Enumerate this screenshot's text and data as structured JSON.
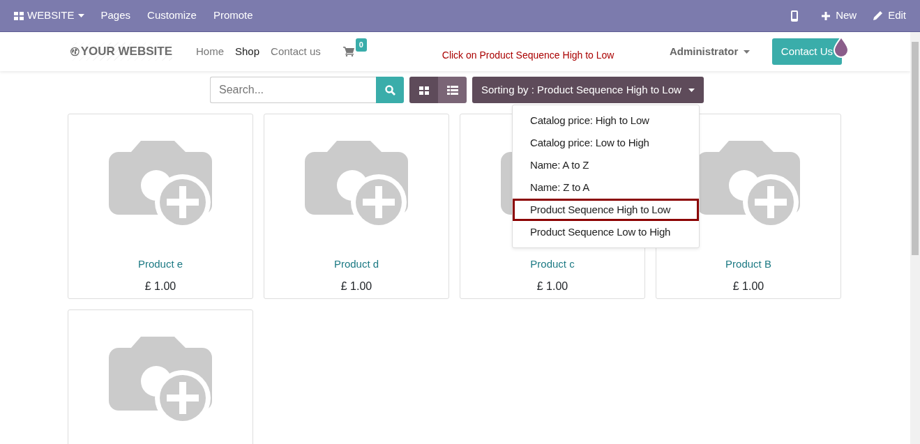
{
  "admin_bar": {
    "app_menu": "WEBSITE",
    "menu": [
      "Pages",
      "Customize",
      "Promote"
    ],
    "actions": [
      {
        "kind": "mobile"
      },
      {
        "kind": "new",
        "label": "New"
      },
      {
        "kind": "edit",
        "label": "Edit"
      }
    ]
  },
  "header": {
    "logo": "YOUR WEBSITE",
    "nav": [
      {
        "label": "Home",
        "selected": false
      },
      {
        "label": "Shop",
        "selected": true
      },
      {
        "label": "Contact us",
        "selected": false
      }
    ],
    "cart_count": "0",
    "annotation": "Click on Product Sequence High to Low",
    "user": "Administrator",
    "contact_button": "Contact Us"
  },
  "toolbar": {
    "search": {
      "placeholder": "Search..."
    },
    "views": [
      {
        "kind": "grid",
        "selected": true
      },
      {
        "kind": "list",
        "selected": false
      }
    ],
    "sort_button": "Sorting by : Product Sequence High to Low"
  },
  "sort_menu": [
    {
      "label": "Catalog price: High to Low",
      "highlighted": false
    },
    {
      "label": "Catalog price: Low to High",
      "highlighted": false
    },
    {
      "label": "Name: A to Z",
      "highlighted": false
    },
    {
      "label": "Name: Z to A",
      "highlighted": false
    },
    {
      "label": "Product Sequence High to Low",
      "highlighted": true
    },
    {
      "label": "Product Sequence Low to High",
      "highlighted": false
    }
  ],
  "products": [
    {
      "kind": "no_image",
      "name": "Product e",
      "price": "£ 1.00"
    },
    {
      "kind": "no_image",
      "name": "Product d",
      "price": "£ 1.00"
    },
    {
      "kind": "no_image",
      "name": "Product c",
      "price": "£ 1.00"
    },
    {
      "kind": "no_image",
      "name": "Product B",
      "price": "£ 1.00"
    },
    {
      "kind": "no_image"
    }
  ]
}
